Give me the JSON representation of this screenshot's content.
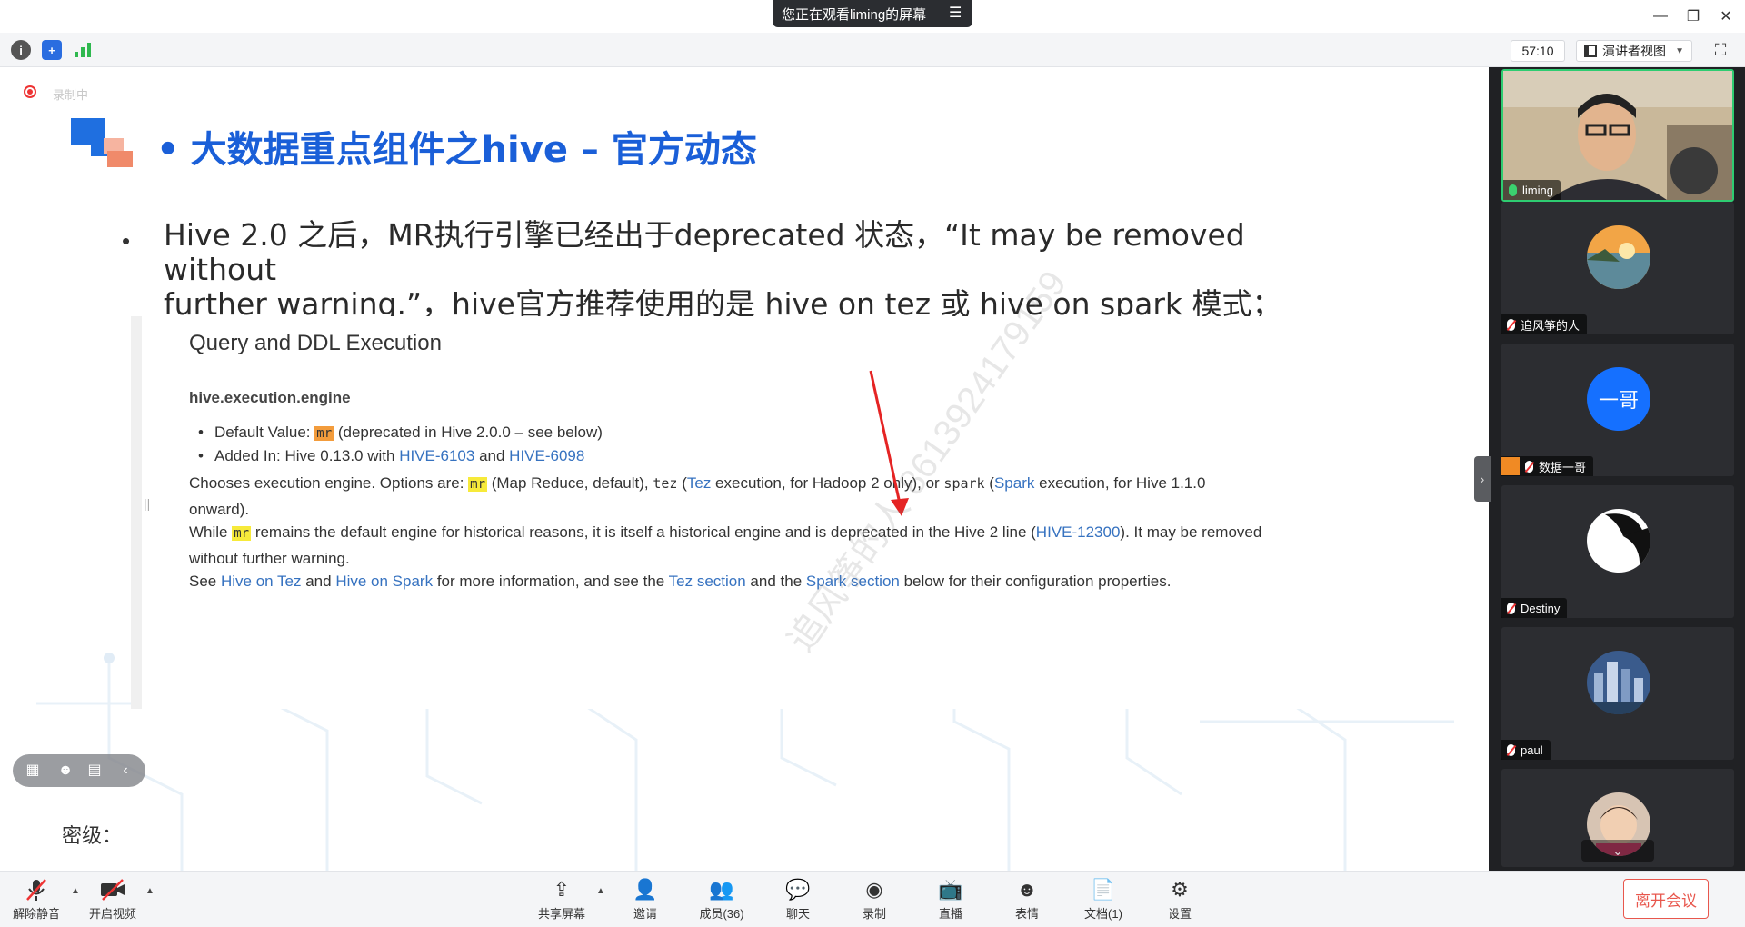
{
  "window": {
    "share_banner": "您正在观看liming的屏幕",
    "menu_icon": "menu-icon",
    "controls": [
      "minimize-icon",
      "restore-icon",
      "close-icon"
    ]
  },
  "topbar": {
    "icons": [
      "info-icon",
      "shield-icon",
      "signal-icon"
    ],
    "timer": "57:10",
    "view_label": "演讲者视图",
    "fullscreen_icon": "fullscreen-icon"
  },
  "slide": {
    "recording_label": "录制中",
    "title_bullet": "•",
    "title": "大数据重点组件之hive – 官方动态",
    "bullet_line1": "Hive 2.0 之后，MR执行引擎已经出于deprecated 状态，“It may be removed without",
    "bullet_line2": "further warning.”，hive官方推荐使用的是 hive on tez 或 hive on spark 模式；",
    "doc": {
      "heading": "Query and DDL Execution",
      "property": "hive.execution.engine",
      "li1_prefix": "Default Value: ",
      "li1_code": "mr",
      "li1_suffix": " (deprecated in Hive 2.0.0 – see below)",
      "li2_prefix": "Added In: Hive 0.13.0 with ",
      "li2_link1": "HIVE-6103",
      "li2_mid": " and ",
      "li2_link2": "HIVE-6098",
      "p1_a": "Chooses execution engine. Options are: ",
      "p1_code1": "mr",
      "p1_b": " (Map Reduce, default), ",
      "p1_code2": "tez",
      "p1_c": " (",
      "p1_link1": "Tez",
      "p1_d": " execution, for Hadoop 2 only), or ",
      "p1_code3": "spark",
      "p1_e": " (",
      "p1_link2": "Spark",
      "p1_f": " execution, for Hive 1.1.0",
      "p1_g": "onward).",
      "p2_a": "While ",
      "p2_code": "mr",
      "p2_b": " remains the default engine for historical reasons, it is itself a historical engine and is deprecated in the Hive 2 line (",
      "p2_link": "HIVE-12300",
      "p2_c": "). It may be removed",
      "p2_d": "without further warning.",
      "p3_a": "See ",
      "p3_link1": "Hive on Tez",
      "p3_b": " and ",
      "p3_link2": "Hive on Spark",
      "p3_c": " for more information, and see the ",
      "p3_link3": "Tez section",
      "p3_d": " and the ",
      "p3_link4": "Spark section",
      "p3_e": " below for their configuration properties."
    },
    "watermark": "追风筝的人 8613924179159",
    "classification_label": "密级："
  },
  "participants": [
    {
      "name": "liming",
      "mic": "on",
      "avatar": "video-feed"
    },
    {
      "name": "追风筝的人",
      "mic": "off",
      "avatar": "landscape-avatar"
    },
    {
      "name": "数据一哥",
      "mic": "off",
      "avatar_text": "一哥",
      "host": true
    },
    {
      "name": "Destiny",
      "mic": "off",
      "avatar": "anime-avatar"
    },
    {
      "name": "paul",
      "mic": "off",
      "avatar": "city-avatar"
    },
    {
      "name": "",
      "mic": "off",
      "avatar": "child-avatar"
    }
  ],
  "toolbar": {
    "mute_label": "解除静音",
    "video_label": "开启视频",
    "share_label": "共享屏幕",
    "invite_label": "邀请",
    "members_label": "成员(36)",
    "chat_label": "聊天",
    "record_label": "录制",
    "live_label": "直播",
    "emoji_label": "表情",
    "docs_label": "文档(1)",
    "settings_label": "设置",
    "leave_label": "离开会议"
  },
  "colors": {
    "title_blue": "#1a5fd8",
    "link_blue": "#3672c0",
    "highlight_yellow": "#f7ea3a",
    "highlight_orange": "#f39c3c",
    "leave_red": "#e8574d",
    "active_green": "#2ecc71"
  }
}
